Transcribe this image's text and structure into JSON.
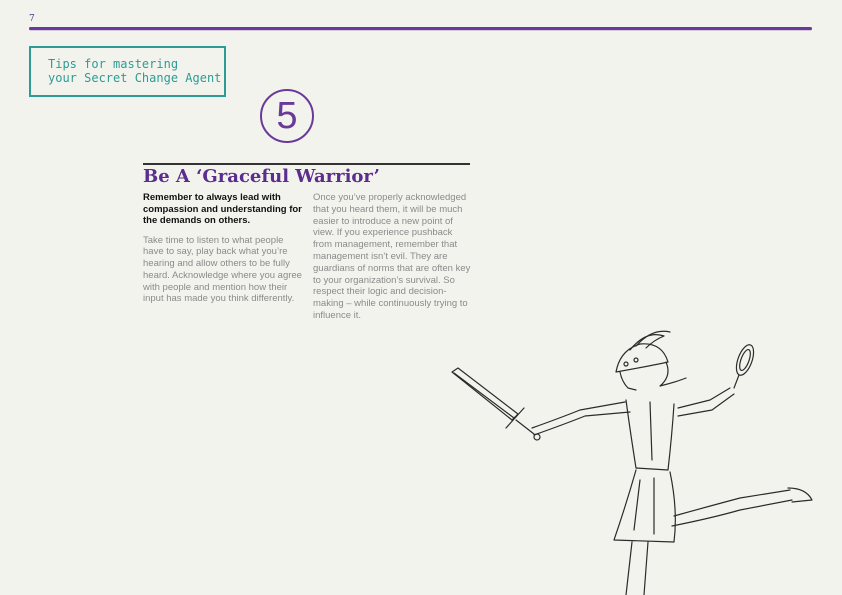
{
  "page": {
    "number": "7"
  },
  "tips_box": {
    "line1": "Tips for mastering",
    "line2": "your Secret Change Agent"
  },
  "step": {
    "number": "5"
  },
  "section": {
    "title": "Be A ‘Graceful Warrior’",
    "lead": "Remember to always lead with compassion and understanding for the demands on others.",
    "left_body": "Take time to listen to what people have to say, play back what you’re hearing and allow others to be fully heard. Acknowledge where you agree with people and mention how their input has made you think differently.",
    "right_body": "Once you’ve properly acknowledged that you heard them, it will be much easier to introduce a new point of view. If you experience pushback from management, remember that management isn’t evil. They are guardians of norms that are often key to your organization’s survival. So respect their logic and decision-making – while continuously trying to influence it."
  },
  "colors": {
    "purple": "#5b2d8e",
    "teal": "#2a9d94",
    "background": "#f3f3ee"
  }
}
